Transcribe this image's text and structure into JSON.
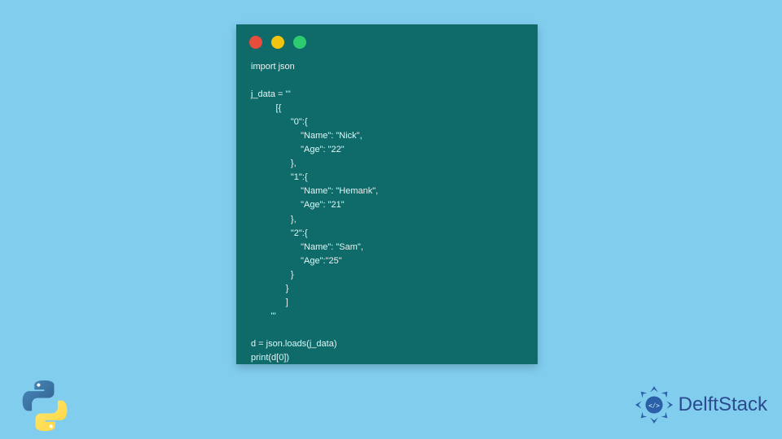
{
  "code": {
    "lines": "import json\n\nj_data = '''\n          [{\n                \"0\":{\n                    \"Name\": \"Nick\",\n                    \"Age\": \"22\"\n                },\n                \"1\":{\n                    \"Name\": \"Hemank\",\n                    \"Age\": \"21\"\n                },\n                \"2\":{\n                    \"Name\": \"Sam\",\n                    \"Age\":\"25\"\n                }\n              }\n              ]\n        '''\n\nd = json.loads(j_data)\nprint(d[0])"
  },
  "brand": {
    "name": "DelftStack"
  }
}
